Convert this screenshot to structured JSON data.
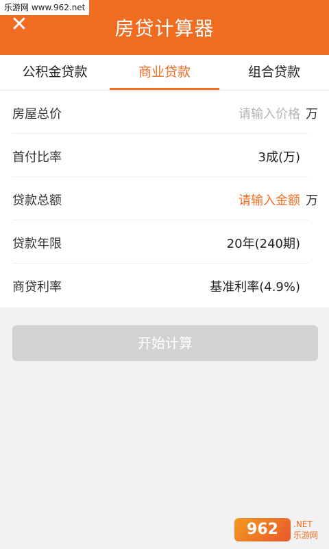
{
  "watermark": {
    "top_text": "乐游网 www.962.net",
    "bottom_logo": "962",
    "bottom_suffix": ".NET",
    "bottom_brand": "乐游网"
  },
  "header": {
    "title": "房贷计算器",
    "close_symbol": "✕"
  },
  "tabs": [
    {
      "label": "公积金贷款",
      "active": false
    },
    {
      "label": "商业贷款",
      "active": true
    },
    {
      "label": "组合贷款",
      "active": false
    }
  ],
  "form": {
    "rows": [
      {
        "label": "房屋总价",
        "value": "请输入价格",
        "unit": "万"
      },
      {
        "label": "首付比率",
        "value": "3成(万)",
        "unit": ""
      },
      {
        "label": "贷款总额",
        "value": "请输入金额",
        "unit": "万"
      },
      {
        "label": "贷款年限",
        "value": "20年(240期)",
        "unit": ""
      },
      {
        "label": "商贷利率",
        "value": "基准利率(4.9%)",
        "unit": ""
      }
    ]
  },
  "actions": {
    "start_label": "开始计算"
  },
  "colors": {
    "accent": "#f06c21",
    "button_disabled": "#d2d2d2"
  }
}
